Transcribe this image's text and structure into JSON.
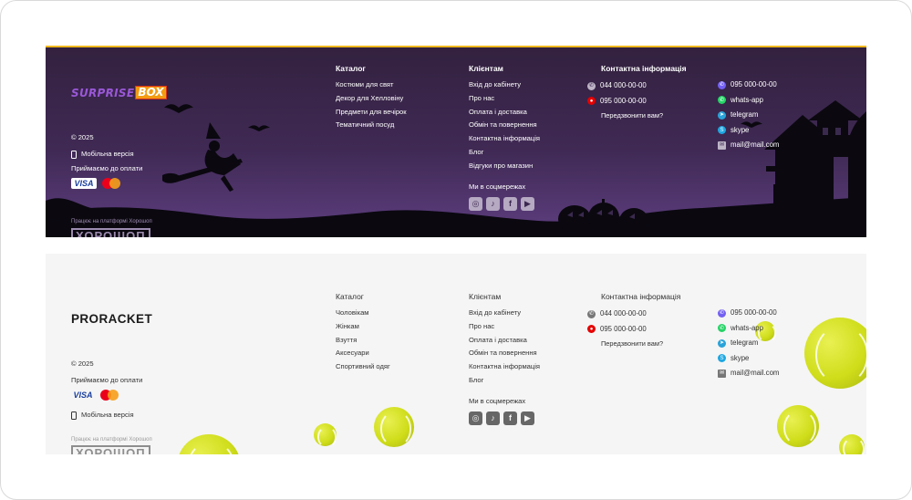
{
  "footer1": {
    "logo": {
      "word1": "SURPRISE",
      "word2": "BOX"
    },
    "copyright": "© 2025",
    "mobile": "Мобільна версія",
    "payment_label": "Приймаємо до оплати",
    "visa": "VISA",
    "platform": "Працює на платформі Хорошоп",
    "platform_logo": "ХОРОШОП",
    "catalog": {
      "title": "Каталог",
      "items": [
        "Костюми для свят",
        "Декор для Хелловіну",
        "Предмети для вечірок",
        "Тематичний посуд"
      ]
    },
    "clients": {
      "title": "Клієнтам",
      "items": [
        "Вхід до кабінету",
        "Про нас",
        "Оплата і доставка",
        "Обмін та повернення",
        "Контактна інформація",
        "Блог",
        "Відгуки про магазин"
      ],
      "social_title": "Ми в соцмережах"
    },
    "contacts": {
      "title": "Контактна інформація",
      "phone1": "044 000-00-00",
      "phone2": "095 000-00-00",
      "callback": "Передзвонити вам?",
      "viber": "095 000-00-00",
      "whatsapp": "whats-app",
      "telegram": "telegram",
      "skype": "skype",
      "email": "mail@mail.com"
    }
  },
  "footer2": {
    "logo": "PRORACKET",
    "copyright": "© 2025",
    "payment_label": "Приймаємо до оплати",
    "visa": "VISA",
    "mobile": "Мобільна версія",
    "platform": "Працює на платформі Хорошоп",
    "platform_logo": "ХОРОШОП",
    "catalog": {
      "title": "Каталог",
      "items": [
        "Чоловікам",
        "Жінкам",
        "Взуття",
        "Аксесуари",
        "Спортивний одяг"
      ]
    },
    "clients": {
      "title": "Клієнтам",
      "items": [
        "Вхід до кабінету",
        "Про нас",
        "Оплата і доставка",
        "Обмін та повернення",
        "Контактна інформація",
        "Блог"
      ],
      "social_title": "Ми в соцмережах"
    },
    "contacts": {
      "title": "Контактна інформація",
      "phone1": "044 000-00-00",
      "phone2": "095 000-00-00",
      "callback": "Передзвонити вам?",
      "viber": "095 000-00-00",
      "whatsapp": "whats-app",
      "telegram": "telegram",
      "skype": "skype",
      "email": "mail@mail.com"
    }
  },
  "colors": {
    "dark_bg": "#3d2850",
    "accent_yellow": "#f0b81d",
    "light_bg": "#f5f5f5",
    "ball": "#d4e021"
  },
  "icons": {
    "social": [
      "instagram-icon",
      "tiktok-icon",
      "facebook-icon",
      "youtube-icon"
    ],
    "contacts": [
      "phone-icon",
      "vodafone-icon",
      "viber-icon",
      "whatsapp-icon",
      "telegram-icon",
      "skype-icon",
      "mail-icon"
    ]
  }
}
